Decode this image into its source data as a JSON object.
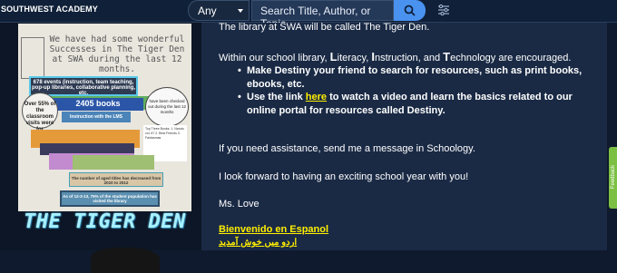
{
  "header": {
    "brand": "SOUTHWEST ACADEMY",
    "search_type": "Any",
    "search_placeholder": "Search Title, Author, or Topic"
  },
  "icons": {
    "search": "search-icon",
    "filter": "sliders-icon",
    "caret": "chevron-down-icon"
  },
  "poster": {
    "title": "We have had some wonderful Successes in The Tiger Den at SWA during the last 12 months.",
    "items_box": "678 events (instruction, team teaching, pop-up libraries, collaborative planning, etc.",
    "books_count": "2405 books",
    "classroom_visits": "Over 55% of the classroom visits were for",
    "instruction": "Instruction with the LMS",
    "checked_out": "have been checked out during the last 12 months",
    "top_three": "Top Three Books: 1. Naruto vol. 67 2. Best Friends 3. Fantasmas",
    "aged_titles": "The number of aged titles has decreased from 2010 to 2012",
    "students": "As of 12-3-13, 75% of the student population has visited the library",
    "tiger_den": "THE TIGER DEN"
  },
  "main": {
    "line0": "The library at SWA will be called The Tiger Den.",
    "intro": {
      "t1": "Within our school library, ",
      "L": "L",
      "t2": "iteracy, ",
      "I": "I",
      "t3": "nstruction, and ",
      "T": "T",
      "t4": "echnology are encouraged."
    },
    "bullet1": "Make Destiny your friend to search for resources, such as print books, ebooks, etc.",
    "bullet2": {
      "pre": "Use the link ",
      "link": "here",
      "post": " to watch a video and learn the basics related to our online portal for resources called Destiny."
    },
    "assist": "If you need assistance, send me a message in Schoology.",
    "forward": "I look forward to having an exciting school year with you!",
    "sign": "Ms. Love",
    "spanish_link": "Bienvenido en Espanol ",
    "urdu_link": "اردو میں خوش آمدید"
  },
  "feedback": "Feedback",
  "colors": {
    "topbar": "#0f2038",
    "main_bg": "#1a2a45",
    "link_yellow": "#ffee00",
    "search_button": "#4a92f0",
    "feedback_green": "#7bc043"
  }
}
